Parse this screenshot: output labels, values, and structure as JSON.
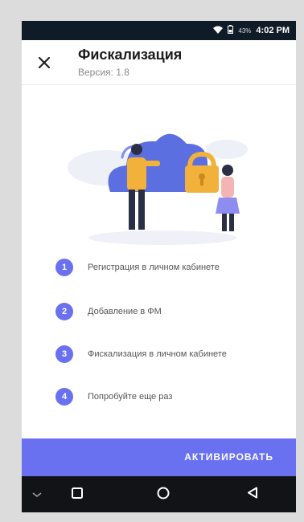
{
  "status_bar": {
    "battery_percent": "43%",
    "time": "4:02 PM"
  },
  "header": {
    "title": "Фискализация",
    "version": "Версия: 1.8"
  },
  "steps": [
    {
      "number": "1",
      "label": "Регистрация в личном кабинете"
    },
    {
      "number": "2",
      "label": "Добавление в ФМ"
    },
    {
      "number": "3",
      "label": "Фискализация в личном кабинете"
    },
    {
      "number": "4",
      "label": "Попробуйте еще раз"
    }
  ],
  "action": {
    "label": "АКТИВИРОВАТЬ"
  },
  "colors": {
    "accent": "#6a71f0",
    "status_bar": "#0f1b26",
    "nav_bar": "#111316",
    "cloud": "#5b6fe0",
    "lock": "#f2b13a"
  },
  "icons": [
    "wifi-icon",
    "battery-icon",
    "close-icon",
    "back-icon",
    "home-icon",
    "recents-icon"
  ]
}
